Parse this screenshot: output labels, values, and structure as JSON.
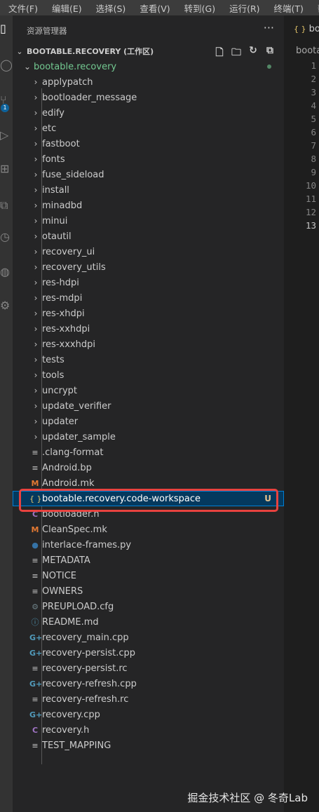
{
  "menubar": {
    "items": [
      "文件(F)",
      "编辑(E)",
      "选择(S)",
      "查看(V)",
      "转到(G)",
      "运行(R)",
      "终端(T)",
      "帮助(H)"
    ]
  },
  "activitybar": {
    "icons": [
      "explorer-icon",
      "search-icon",
      "source-control-icon",
      "run-debug-icon",
      "extensions-icon",
      "remote-icon",
      "test-icon",
      "accounts-icon",
      "settings-icon"
    ],
    "source_control_badge": "1"
  },
  "sidebar": {
    "title": "资源管理器",
    "more": "···",
    "workspace_title": "BOOTABLE.RECOVERY (工作区)",
    "root_folder": "bootable.recovery",
    "folders": [
      "applypatch",
      "bootloader_message",
      "edify",
      "etc",
      "fastboot",
      "fonts",
      "fuse_sideload",
      "install",
      "minadbd",
      "minui",
      "otautil",
      "recovery_ui",
      "recovery_utils",
      "res-hdpi",
      "res-mdpi",
      "res-xhdpi",
      "res-xxhdpi",
      "res-xxxhdpi",
      "tests",
      "tools",
      "uncrypt",
      "update_verifier",
      "updater",
      "updater_sample"
    ],
    "files": [
      {
        "name": ".clang-format",
        "icon": "lines"
      },
      {
        "name": "Android.bp",
        "icon": "lines"
      },
      {
        "name": "Android.mk",
        "icon": "m"
      },
      {
        "name": "bootable.recovery.code-workspace",
        "icon": "brace",
        "status": "U",
        "selected": true
      },
      {
        "name": "bootloader.h",
        "icon": "c"
      },
      {
        "name": "CleanSpec.mk",
        "icon": "m"
      },
      {
        "name": "interlace-frames.py",
        "icon": "py"
      },
      {
        "name": "METADATA",
        "icon": "lines"
      },
      {
        "name": "NOTICE",
        "icon": "lines"
      },
      {
        "name": "OWNERS",
        "icon": "lines"
      },
      {
        "name": "PREUPLOAD.cfg",
        "icon": "gear"
      },
      {
        "name": "README.md",
        "icon": "info"
      },
      {
        "name": "recovery_main.cpp",
        "icon": "cpp"
      },
      {
        "name": "recovery-persist.cpp",
        "icon": "cpp"
      },
      {
        "name": "recovery-persist.rc",
        "icon": "lines"
      },
      {
        "name": "recovery-refresh.cpp",
        "icon": "cpp"
      },
      {
        "name": "recovery-refresh.rc",
        "icon": "lines"
      },
      {
        "name": "recovery.cpp",
        "icon": "cpp"
      },
      {
        "name": "recovery.h",
        "icon": "c"
      },
      {
        "name": "TEST_MAPPING",
        "icon": "lines"
      }
    ]
  },
  "editor": {
    "tab_label": "boot",
    "breadcrumb": "bootab",
    "line_numbers": [
      "1",
      "2",
      "3",
      "4",
      "5",
      "6",
      "7",
      "8",
      "9",
      "10",
      "11",
      "12",
      "13"
    ],
    "current_line": "13"
  },
  "watermark": "掘金技术社区 @ 冬奇Lab",
  "colors": {
    "selection_bg": "#04395e",
    "untracked_green": "#73c991",
    "highlight_box": "#e8423f"
  }
}
